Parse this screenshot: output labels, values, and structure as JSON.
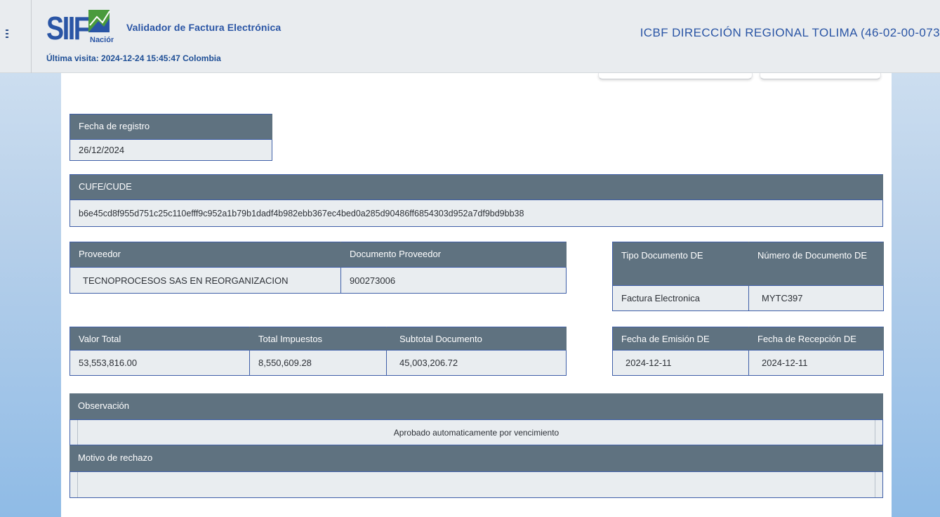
{
  "header": {
    "logo_text": "SIIF",
    "logo_subtext": "Nación",
    "app_title": "Validador de Factura Electrónica",
    "last_visit": "Última visita: 2024-12-24 15:45:47 Colombia",
    "entity": "ICBF DIRECCIÓN REGIONAL TOLIMA (46-02-00-073"
  },
  "registro": {
    "label": "Fecha de registro",
    "value": "26/12/2024"
  },
  "cufe": {
    "label": "CUFE/CUDE",
    "value": "b6e45cd8f955d751c25c110efff9c952a1b79b1dadf4b982ebb367ec4bed0a285d90486ff6854303d952a7df9bd9bb38"
  },
  "proveedor": {
    "headers": [
      "Proveedor",
      "Documento Proveedor"
    ],
    "values": [
      "TECNOPROCESOS SAS EN REORGANIZACION",
      "900273006"
    ]
  },
  "documento": {
    "headers": [
      "Tipo Documento DE",
      "Número de Documento DE"
    ],
    "values": [
      "Factura Electronica",
      "MYTC397"
    ]
  },
  "valores": {
    "headers": [
      "Valor Total",
      "Total Impuestos",
      "Subtotal Documento"
    ],
    "values": [
      "53,553,816.00",
      "8,550,609.28",
      "45,003,206.72"
    ]
  },
  "fechas": {
    "headers": [
      "Fecha de Emisión DE",
      "Fecha de Recepción DE"
    ],
    "values": [
      "2024-12-11",
      "2024-12-11"
    ]
  },
  "observacion": {
    "label": "Observación",
    "value": "Aprobado automaticamente por vencimiento"
  },
  "rechazo": {
    "label": "Motivo de rechazo",
    "value": ""
  },
  "colors": {
    "header_bg": "#e9ecef",
    "table_head": "#5f7280",
    "table_cell": "#e9edf0",
    "accent_blue": "#2a55a5",
    "border_blue": "#3f5fa8"
  },
  "icons": [
    "menu-icon",
    "siif-logo"
  ]
}
